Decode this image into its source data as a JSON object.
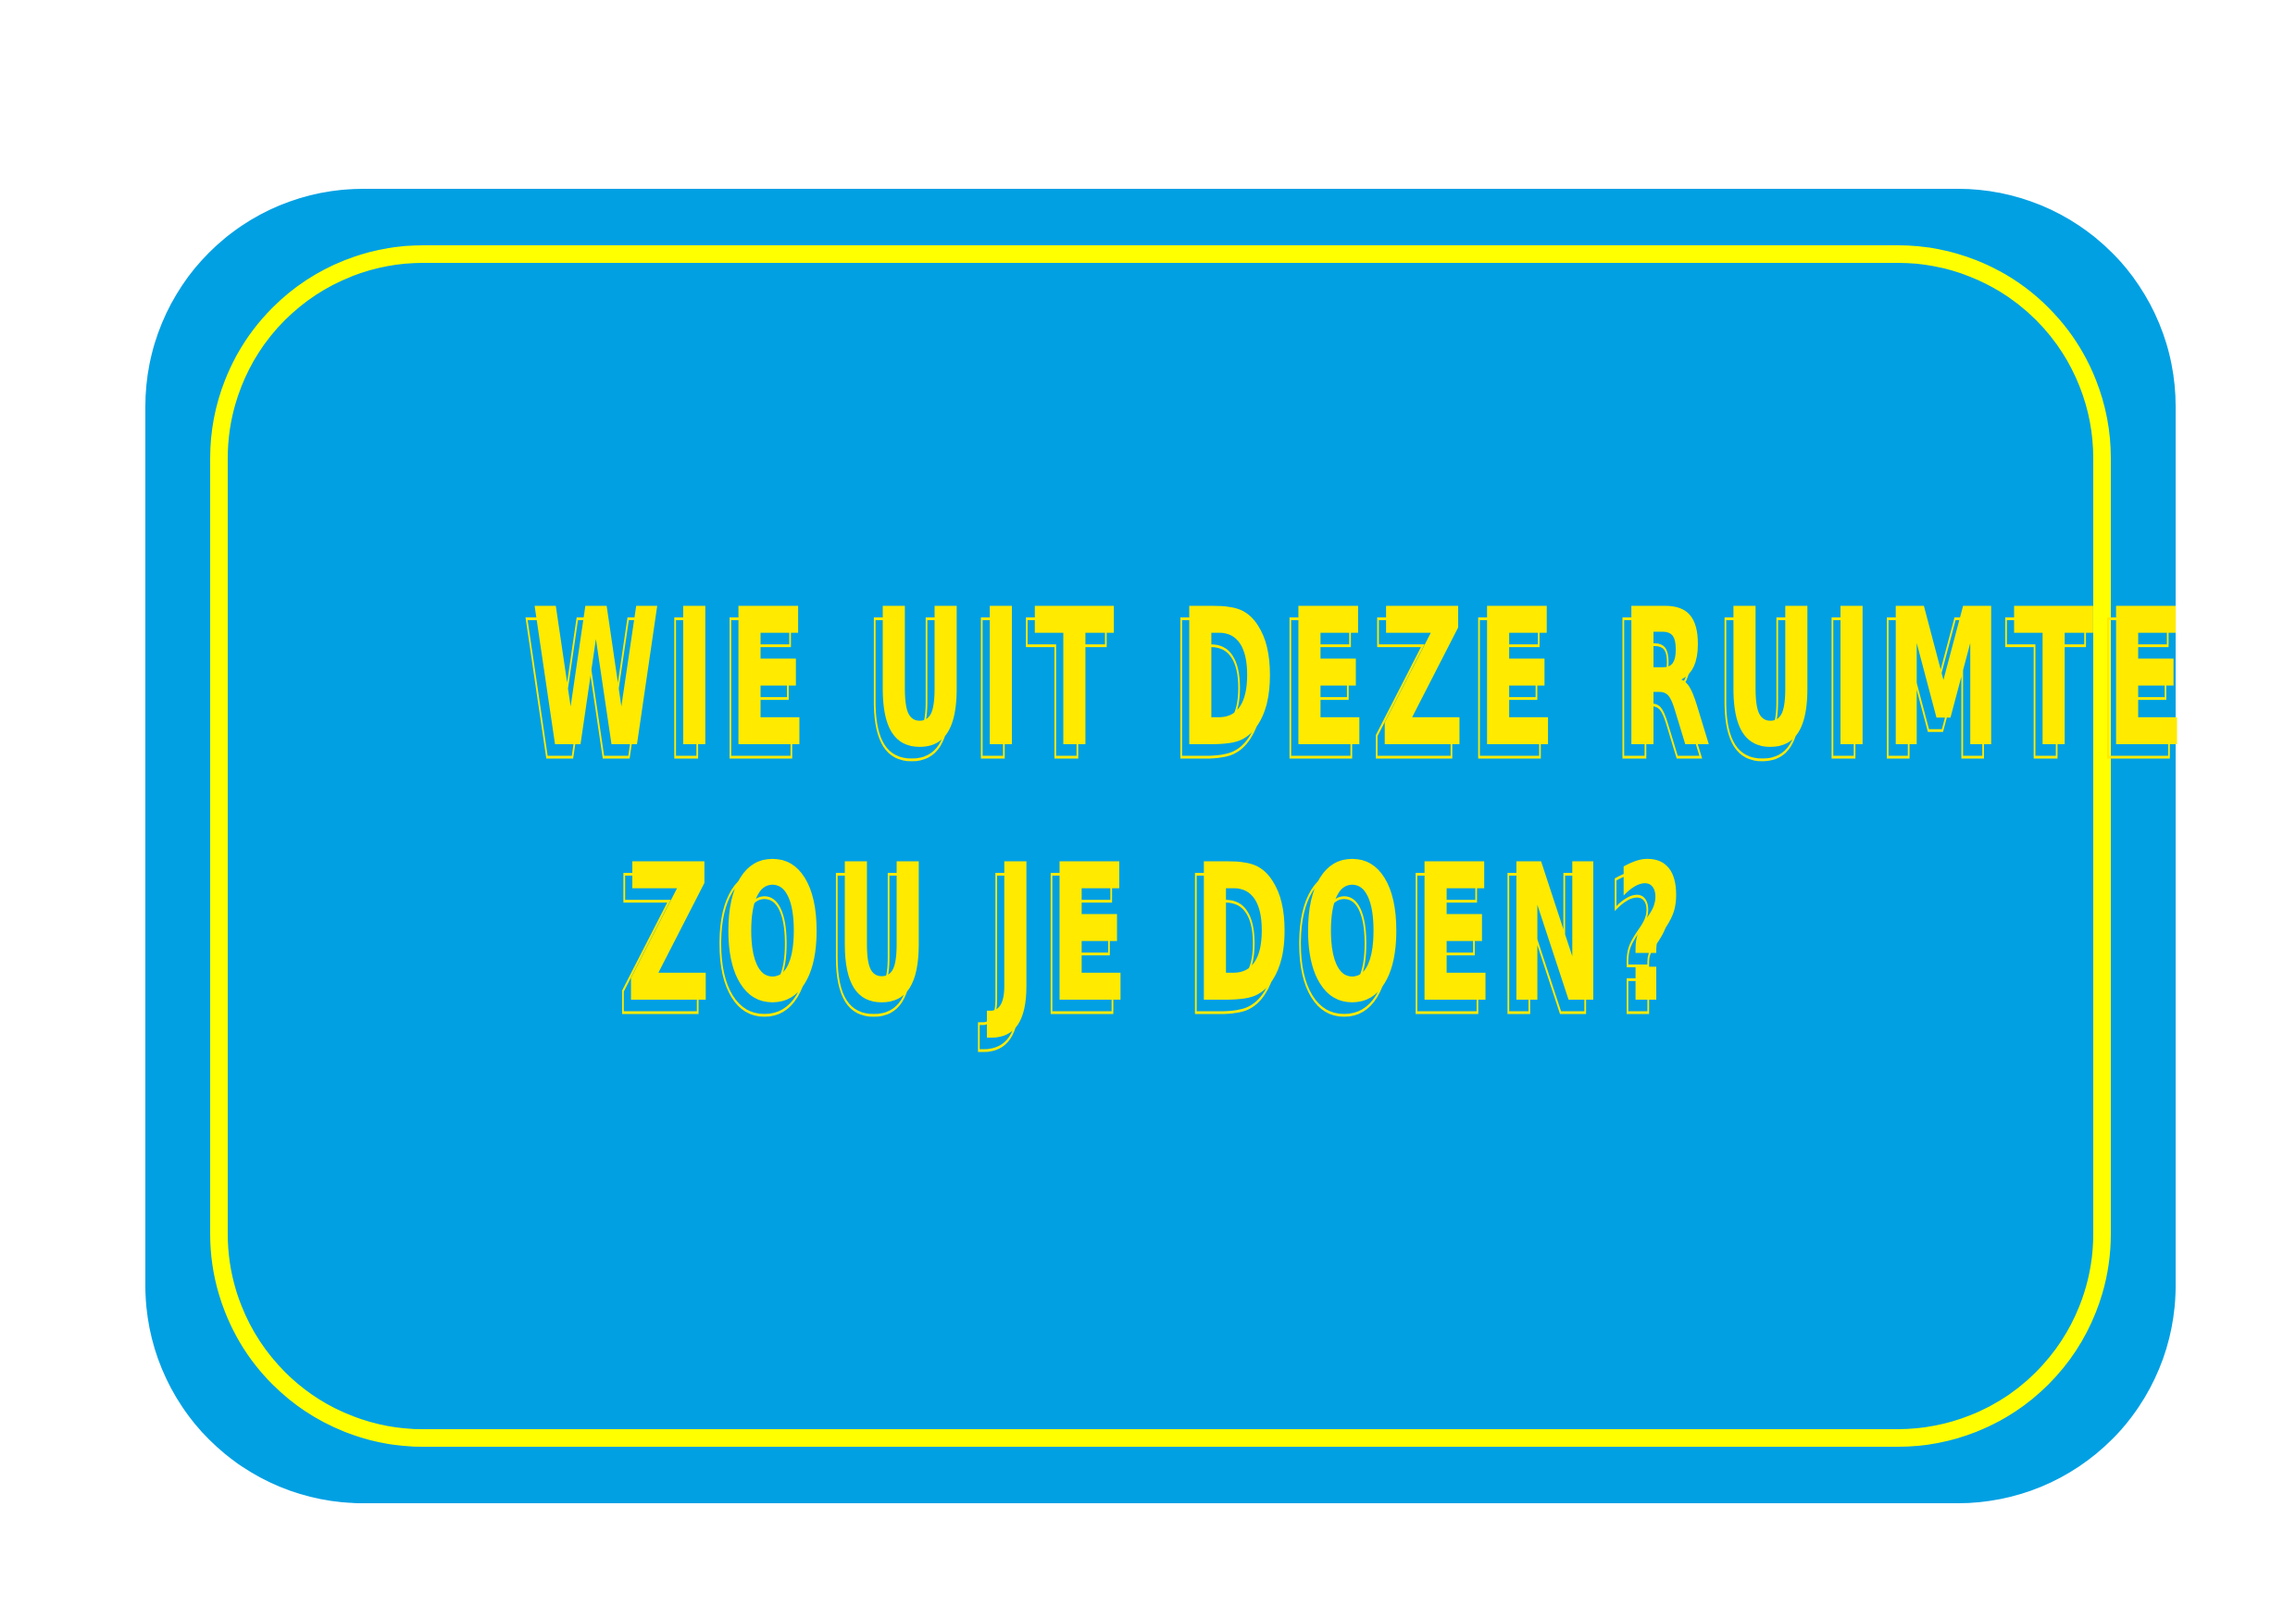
{
  "card": {
    "line_1": "WIE UIT DEZE RUIMTE",
    "line_2": "ZOU JE DOEN?"
  },
  "colors": {
    "background": "#ffffff",
    "card_fill": "#00a0e3",
    "accent_yellow": "#ffea00",
    "frame_yellow": "#ffff00"
  }
}
